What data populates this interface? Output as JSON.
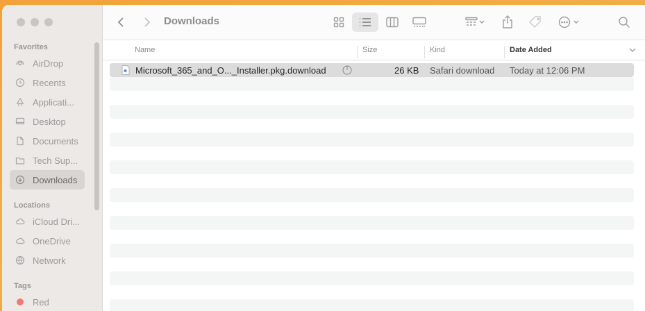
{
  "window": {
    "title": "Downloads"
  },
  "sidebar": {
    "favorites_heading": "Favorites",
    "favorites": [
      {
        "label": "AirDrop",
        "icon": "airdrop-icon"
      },
      {
        "label": "Recents",
        "icon": "clock-icon"
      },
      {
        "label": "Applicati...",
        "icon": "applications-icon"
      },
      {
        "label": "Desktop",
        "icon": "desktop-icon"
      },
      {
        "label": "Documents",
        "icon": "document-icon"
      },
      {
        "label": "Tech Sup...",
        "icon": "folder-icon"
      },
      {
        "label": "Downloads",
        "icon": "download-icon",
        "active": true
      }
    ],
    "locations_heading": "Locations",
    "locations": [
      {
        "label": "iCloud Dri...",
        "icon": "cloud-icon"
      },
      {
        "label": "OneDrive",
        "icon": "cloud-icon"
      },
      {
        "label": "Network",
        "icon": "globe-icon"
      }
    ],
    "tags_heading": "Tags",
    "tags": [
      {
        "label": "Red",
        "color": "#f07a78"
      }
    ]
  },
  "columns": {
    "name": "Name",
    "size": "Size",
    "kind": "Kind",
    "date_added": "Date Added"
  },
  "files": [
    {
      "name": "Microsoft_365_and_O..._Installer.pkg.download",
      "size": "26 KB",
      "kind": "Safari download",
      "date_added": "Today at 12:06 PM"
    }
  ],
  "colors": {
    "selected_row": "#dcdcdc",
    "alt_row": "#f4f5f5",
    "sidebar_bg": "#ece9e7"
  }
}
